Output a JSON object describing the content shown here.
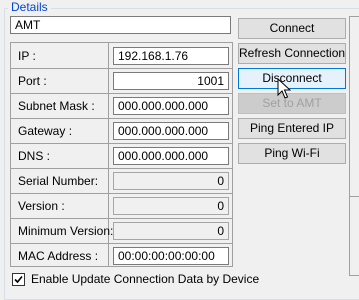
{
  "details": {
    "group_title": "Details",
    "device_name": "AMT",
    "fields": [
      {
        "label": "IP :",
        "value": "192.168.1.76"
      },
      {
        "label": "Port :",
        "value": "1001"
      },
      {
        "label": "Subnet Mask :",
        "value": "000.000.000.000"
      },
      {
        "label": "Gateway :",
        "value": "000.000.000.000"
      },
      {
        "label": "DNS :",
        "value": "000.000.000.000"
      },
      {
        "label": "Serial Number:",
        "value": "0"
      },
      {
        "label": "Version :",
        "value": "0"
      },
      {
        "label": "Minimum Version:",
        "value": "0"
      },
      {
        "label": "MAC Address :",
        "value": "00:00:00:00:00:00"
      }
    ],
    "checkbox_label": "Enable Update Connection Data by Device",
    "checkbox_checked": true
  },
  "buttons": {
    "connect": "Connect",
    "refresh": "Refresh Connection",
    "disconnect": "Disconnect",
    "set_to_amt": "Set to AMT",
    "ping_ip": "Ping Entered IP",
    "ping_wifi": "Ping Wi-Fi"
  }
}
